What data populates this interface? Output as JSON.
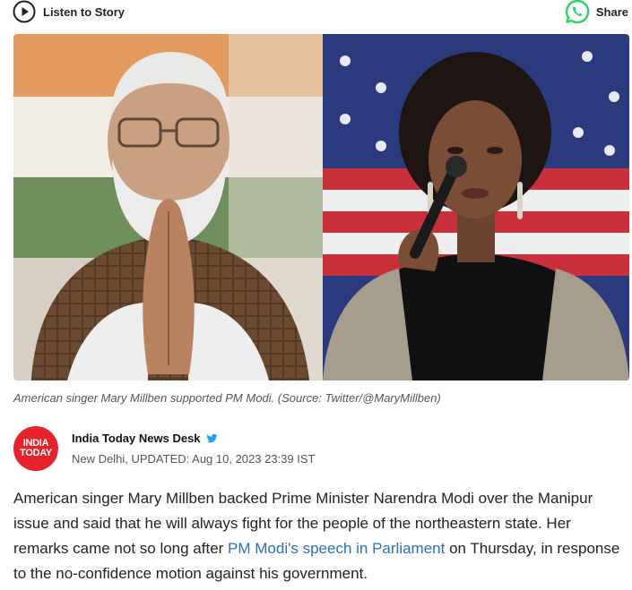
{
  "topbar": {
    "listen_label": "Listen to Story",
    "share_label": "Share"
  },
  "hero": {
    "icons": {
      "left": "narendra-modi-portrait",
      "right": "mary-millben-portrait"
    }
  },
  "caption": "American singer Mary Millben supported PM Modi. (Source: Twitter/@MaryMillben)",
  "byline": {
    "logo_line1": "INDIA",
    "logo_line2": "TODAY",
    "author": "India Today News Desk",
    "location": "New Delhi,",
    "updated": "UPDATED: Aug 10, 2023 23:39 IST"
  },
  "article": {
    "p1_before": "American singer Mary Millben backed Prime Minister Narendra Modi over the Manipur issue and said that he will always fight for the people of the northeastern state. Her remarks came not so long after ",
    "p1_link": "PM Modi's speech in Parliament",
    "p1_after": " on Thursday, in response to the no-confidence motion against his government."
  },
  "colors": {
    "brand_red": "#e6232a",
    "link_blue": "#2d6fb7",
    "whatsapp_green": "#25d366",
    "twitter_blue": "#1da1f2"
  }
}
